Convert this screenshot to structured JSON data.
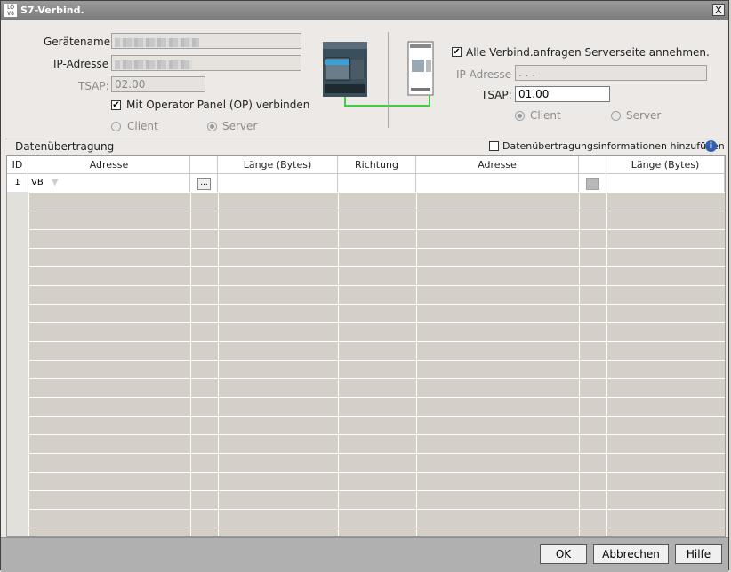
{
  "window": {
    "title": "S7-Verbind.",
    "icon": "app-logo-icon",
    "icon_text": "LOGO\nV8",
    "close_label": "X"
  },
  "left": {
    "device_name_label": "Gerätename:",
    "ip_label": "IP-Adresse",
    "tsap_label": "TSAP:",
    "tsap_value": "02.00",
    "op_panel_label": "Mit Operator Panel (OP) verbinden",
    "op_panel_checked": true,
    "client_label": "Client",
    "server_label": "Server",
    "selected": "Server"
  },
  "right": {
    "accept_all_label": "Alle Verbind.anfragen Serverseite annehmen.",
    "accept_all_checked": true,
    "ip_label": "IP-Adresse",
    "ip_value": ". . .",
    "tsap_label": "TSAP:",
    "tsap_value": "01.00",
    "client_label": "Client",
    "server_label": "Server",
    "selected": "Client"
  },
  "transfer": {
    "section_label": "Datenübertragung",
    "add_info_label": "Datenübertragungsinformationen hinzufügen",
    "add_info_checked": false,
    "info_icon": "info-icon",
    "columns": [
      "ID",
      "Adresse",
      "",
      "Länge (Bytes)",
      "Richtung",
      "Adresse",
      "",
      "Länge (Bytes)"
    ],
    "rows": [
      {
        "id": "1",
        "address": "VB",
        "browse": "...",
        "length": "",
        "direction": "",
        "address2": "",
        "length2": ""
      }
    ]
  },
  "buttons": {
    "ok": "OK",
    "cancel": "Abbrechen",
    "help": "Hilfe"
  },
  "colors": {
    "connector_line": "#3ecf3e",
    "grid_fill": "#d4d0c8"
  }
}
